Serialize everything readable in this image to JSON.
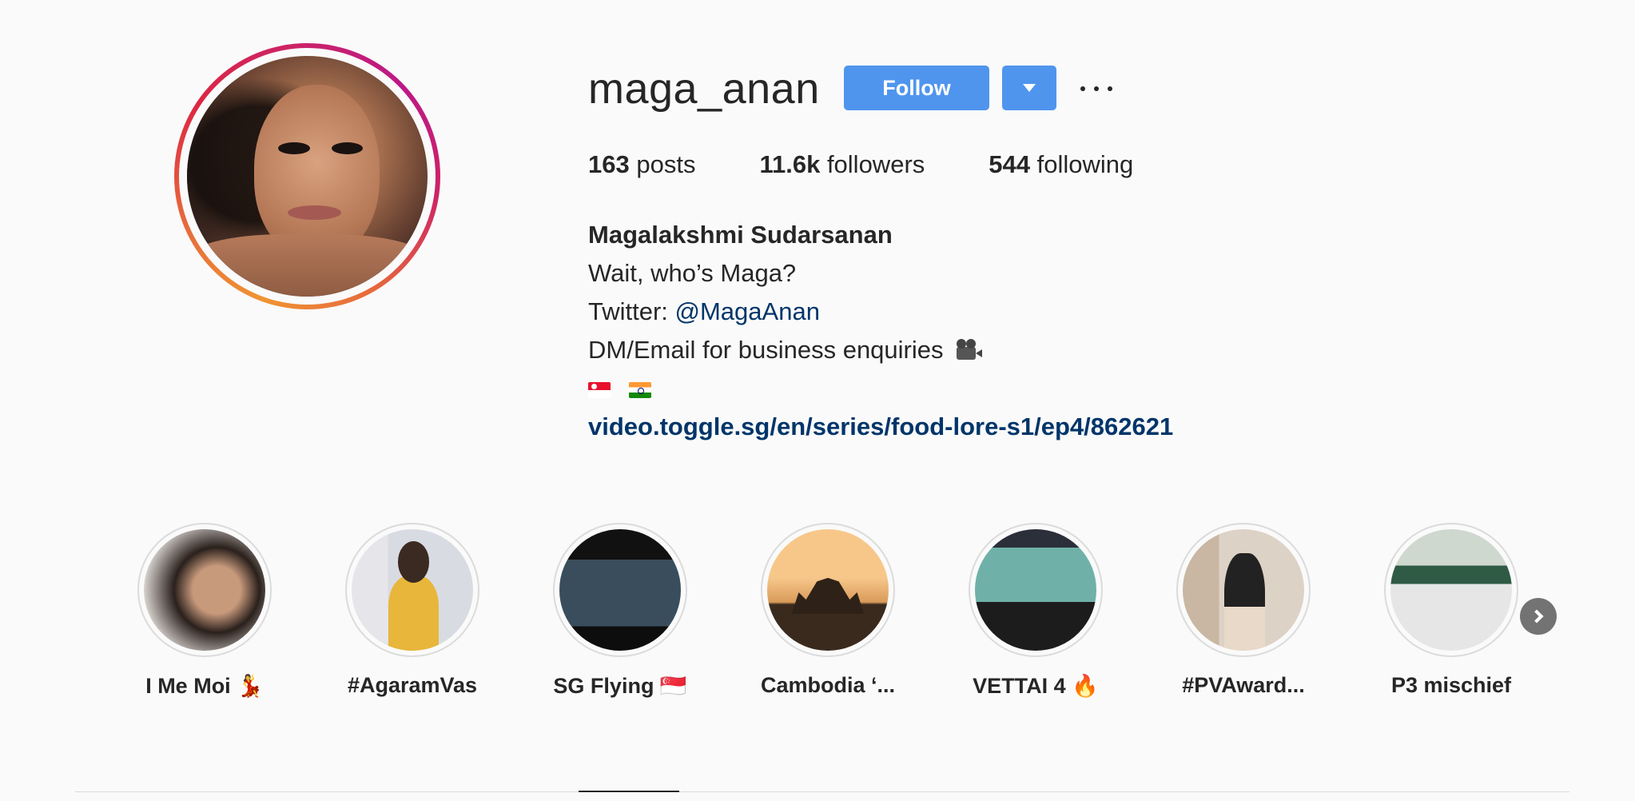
{
  "profile": {
    "username": "maga_anan",
    "follow_label": "Follow",
    "stats": {
      "posts_count": "163",
      "posts_label": " posts",
      "followers_count": "11.6k",
      "followers_label": " followers",
      "following_count": "544",
      "following_label": " following"
    },
    "bio": {
      "full_name": "Magalakshmi Sudarsanan",
      "line1": "Wait, who’s Maga?",
      "twitter_prefix": "Twitter: ",
      "twitter_handle": "@MagaAnan",
      "line3": "DM/Email for business enquiries",
      "flags": [
        "singapore-flag",
        "india-flag"
      ],
      "link": "video.toggle.sg/en/series/food-lore-s1/ep4/862621"
    }
  },
  "highlights": [
    {
      "label": "I Me Moi 💃"
    },
    {
      "label": "#AgaramVas"
    },
    {
      "label": "SG Flying 🇸🇬"
    },
    {
      "label": "Cambodia ‘..."
    },
    {
      "label": "VETTAI 4 🔥"
    },
    {
      "label": "#PVAward..."
    },
    {
      "label": "P3 mischief"
    }
  ],
  "colors": {
    "accent": "#4f95ee",
    "link": "#003569",
    "text": "#262626",
    "background": "#fafafa"
  }
}
